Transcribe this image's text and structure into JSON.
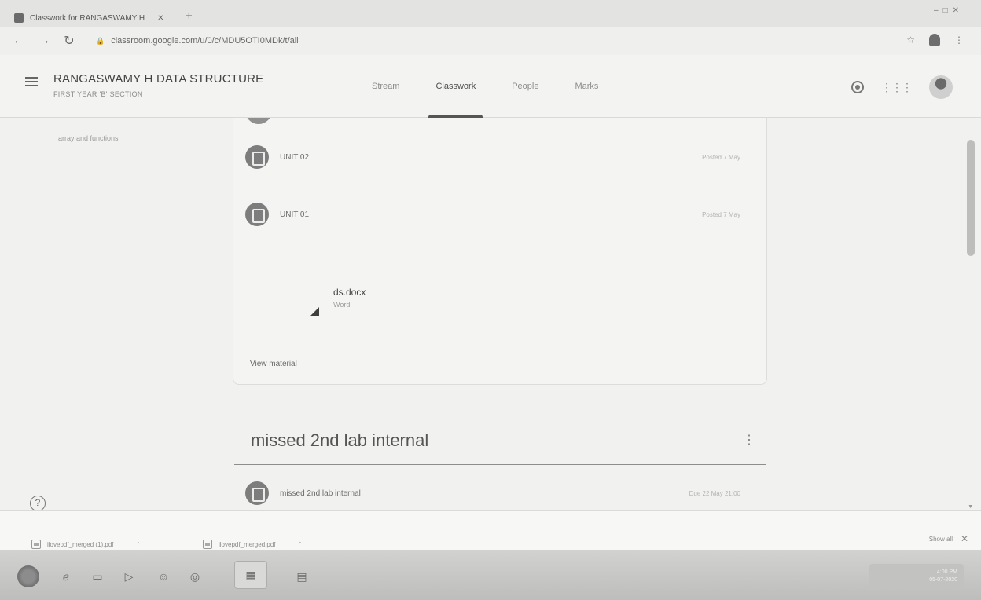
{
  "browser": {
    "tab_title": "Classwork for RANGASWAMY H",
    "url": "classroom.google.com/u/0/c/MDU5OTI0MDk/t/all"
  },
  "classroom": {
    "class_name": "RANGASWAMY H DATA STRUCTURE",
    "section": "FIRST YEAR 'B' SECTION",
    "tabs": [
      "Stream",
      "Classwork",
      "People",
      "Marks"
    ],
    "active_tab": "Classwork"
  },
  "sidebar": {
    "topic_text": "array and functions"
  },
  "materials": [
    {
      "name": "UNIT 02",
      "date": "Posted 7 May"
    },
    {
      "name": "UNIT 01",
      "date": "Posted 7 May"
    }
  ],
  "attachment": {
    "name": "ds.docx",
    "type": "Word"
  },
  "view_material_label": "View material",
  "topic": {
    "title": "missed 2nd lab internal",
    "item_name": "missed 2nd lab internal",
    "item_date": "Due 22 May 21:00"
  },
  "downloads": [
    {
      "name": "ilovepdf_merged (1).pdf"
    },
    {
      "name": "ilovepdf_merged.pdf"
    }
  ],
  "downloads_show_all": "Show all",
  "taskbar": {
    "clock_time": "4:00 PM",
    "clock_date": "05-07-2020"
  }
}
